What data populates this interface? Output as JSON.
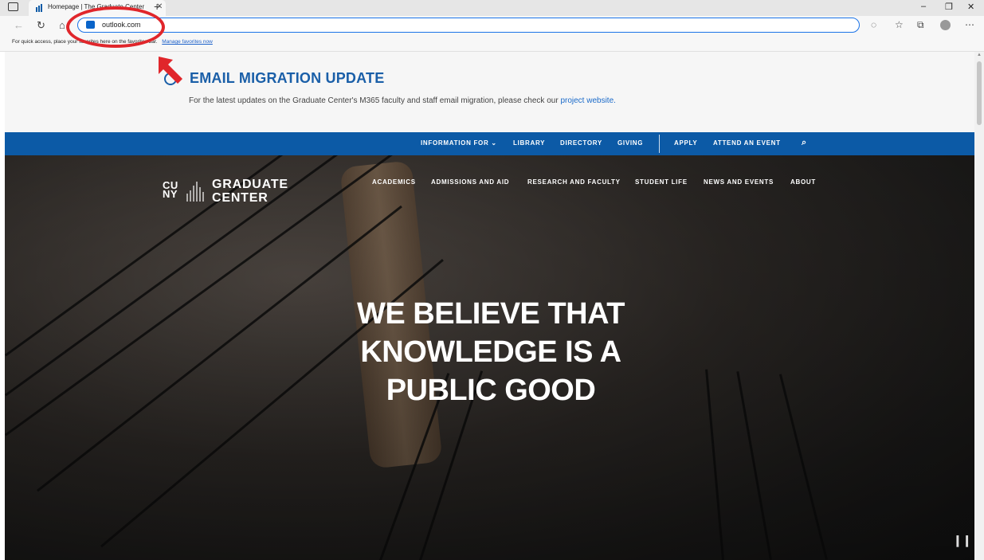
{
  "browser": {
    "tab_title": "Homepage | The Graduate Center",
    "address": "outlook.com",
    "favorites_bar_text": "For quick access, place your favorites here on the favorites bar.",
    "favorites_link": "Manage favorites now"
  },
  "banner": {
    "title": "EMAIL MIGRATION UPDATE",
    "text": "For the latest updates on the Graduate Center's M365 faculty and staff email migration, please check our",
    "link": "project website."
  },
  "top_nav": {
    "items": [
      "INFORMATION FOR",
      "LIBRARY",
      "DIRECTORY",
      "GIVING",
      "APPLY",
      "ATTEND AN EVENT"
    ]
  },
  "logo": {
    "cuny": "CU NY",
    "line1": "GRADUATE",
    "line2": "CENTER"
  },
  "main_nav": {
    "items": [
      "ACADEMICS",
      "ADMISSIONS AND AID",
      "RESEARCH AND FACULTY",
      "STUDENT LIFE",
      "NEWS AND EVENTS",
      "ABOUT"
    ]
  },
  "hero": {
    "headline": "WE BELIEVE THAT KNOWLEDGE IS A PUBLIC GOOD"
  },
  "colors": {
    "nav_blue": "#0c5aa6",
    "banner_title": "#1a5fa8",
    "annotation_red": "#e0262b"
  },
  "icons": [
    "tab-actions-icon",
    "back-icon",
    "refresh-icon",
    "home-icon",
    "outlook-icon",
    "read-aloud-icon",
    "favorite-star-icon",
    "collections-icon",
    "profile-icon",
    "more-icon",
    "search-icon",
    "chevron-down-icon",
    "pause-icon"
  ]
}
